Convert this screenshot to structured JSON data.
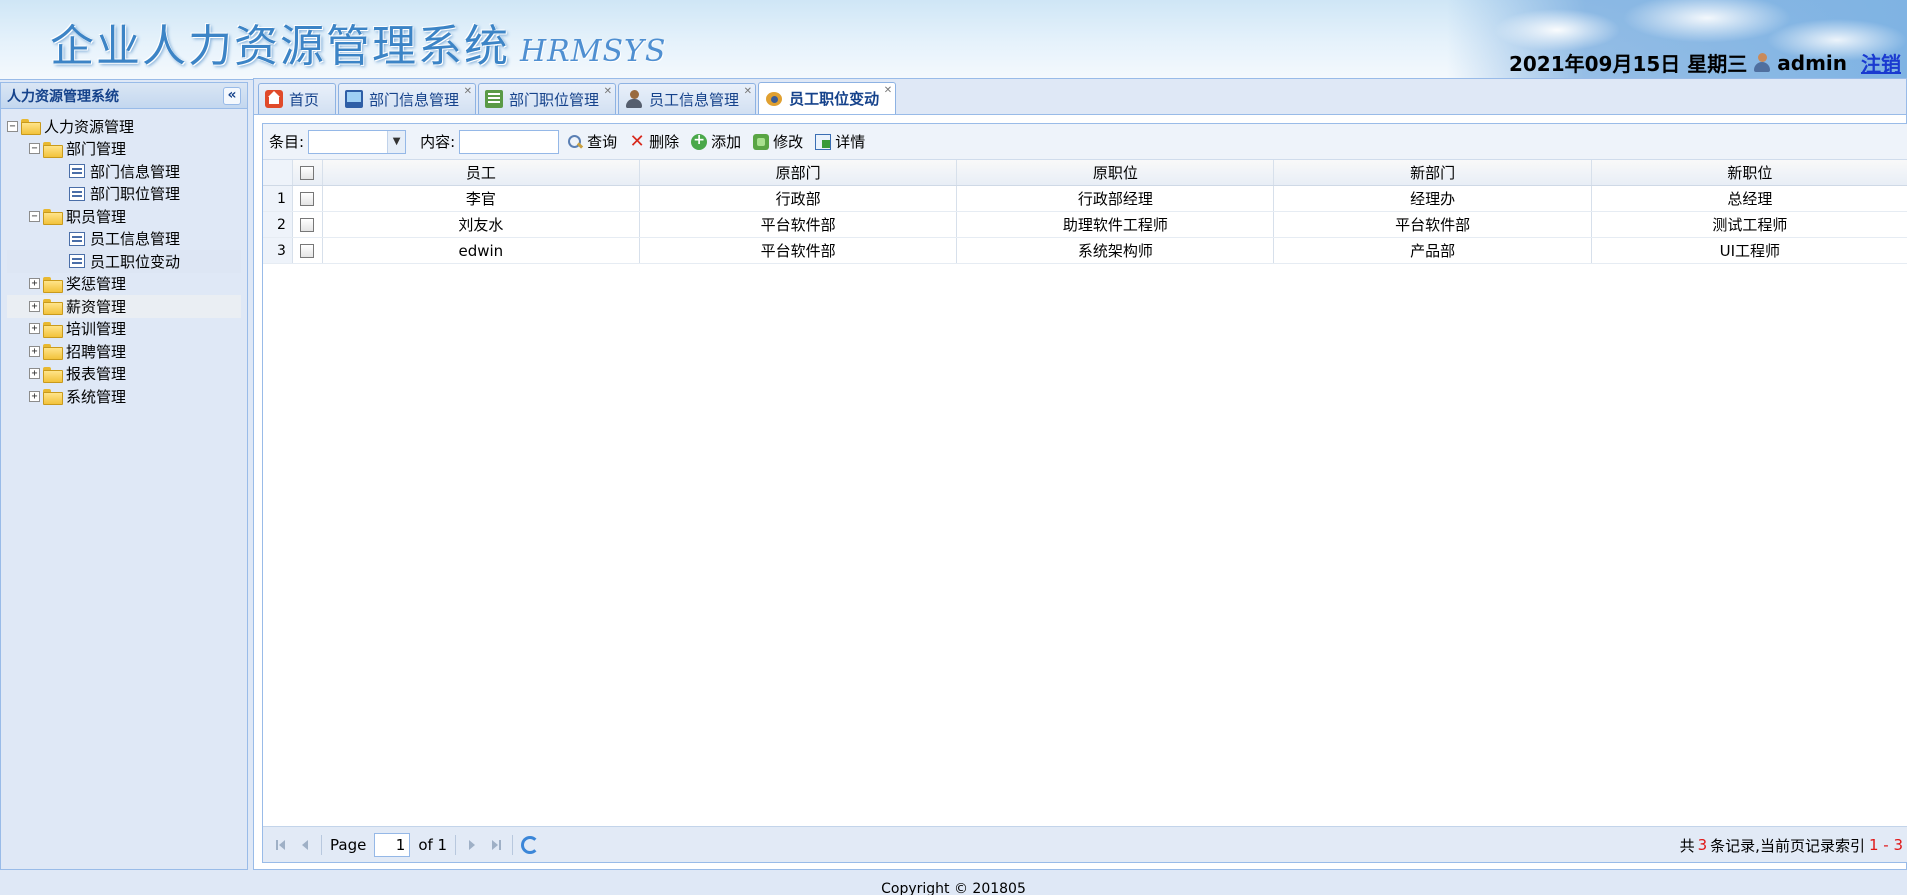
{
  "header": {
    "title": "企业人力资源管理系统",
    "subtitle": "HRMSYS",
    "date": "2021年09月15日 星期三",
    "user": "admin",
    "logout": "注销"
  },
  "sidebar": {
    "title": "人力资源管理系统",
    "collapse_glyph": "«",
    "tree": {
      "root": "人力资源管理",
      "dept": "部门管理",
      "dept_info": "部门信息管理",
      "dept_post": "部门职位管理",
      "staff": "职员管理",
      "staff_info": "员工信息管理",
      "staff_change": "员工职位变动",
      "reward": "奖惩管理",
      "salary": "薪资管理",
      "training": "培训管理",
      "recruit": "招聘管理",
      "report": "报表管理",
      "system": "系统管理"
    }
  },
  "tabs": {
    "home": "首页",
    "dept_info": "部门信息管理",
    "dept_post": "部门职位管理",
    "staff_info": "员工信息管理",
    "staff_change": "员工职位变动"
  },
  "toolbar": {
    "item_label": "条目:",
    "content_label": "内容:",
    "search": "查询",
    "delete": "删除",
    "add": "添加",
    "edit": "修改",
    "detail": "详情"
  },
  "grid": {
    "columns": [
      "员工",
      "原部门",
      "原职位",
      "新部门",
      "新职位"
    ],
    "rows": [
      {
        "num": "1",
        "cells": [
          "李官",
          "行政部",
          "行政部经理",
          "经理办",
          "总经理"
        ]
      },
      {
        "num": "2",
        "cells": [
          "刘友水",
          "平台软件部",
          "助理软件工程师",
          "平台软件部",
          "测试工程师"
        ]
      },
      {
        "num": "3",
        "cells": [
          "edwin",
          "平台软件部",
          "系统架构师",
          "产品部",
          "UI工程师"
        ]
      }
    ]
  },
  "pager": {
    "page_label": "Page",
    "page_value": "1",
    "of_label": "of 1",
    "info_prefix": "共",
    "total": "3",
    "info_mid": "条记录,当前页记录索引",
    "range": "1 - 3"
  },
  "footer": {
    "copyright": "Copyright © 201805"
  },
  "colors": {
    "accent": "#15428b",
    "border": "#99bbe8",
    "highlight": "#e01818"
  }
}
